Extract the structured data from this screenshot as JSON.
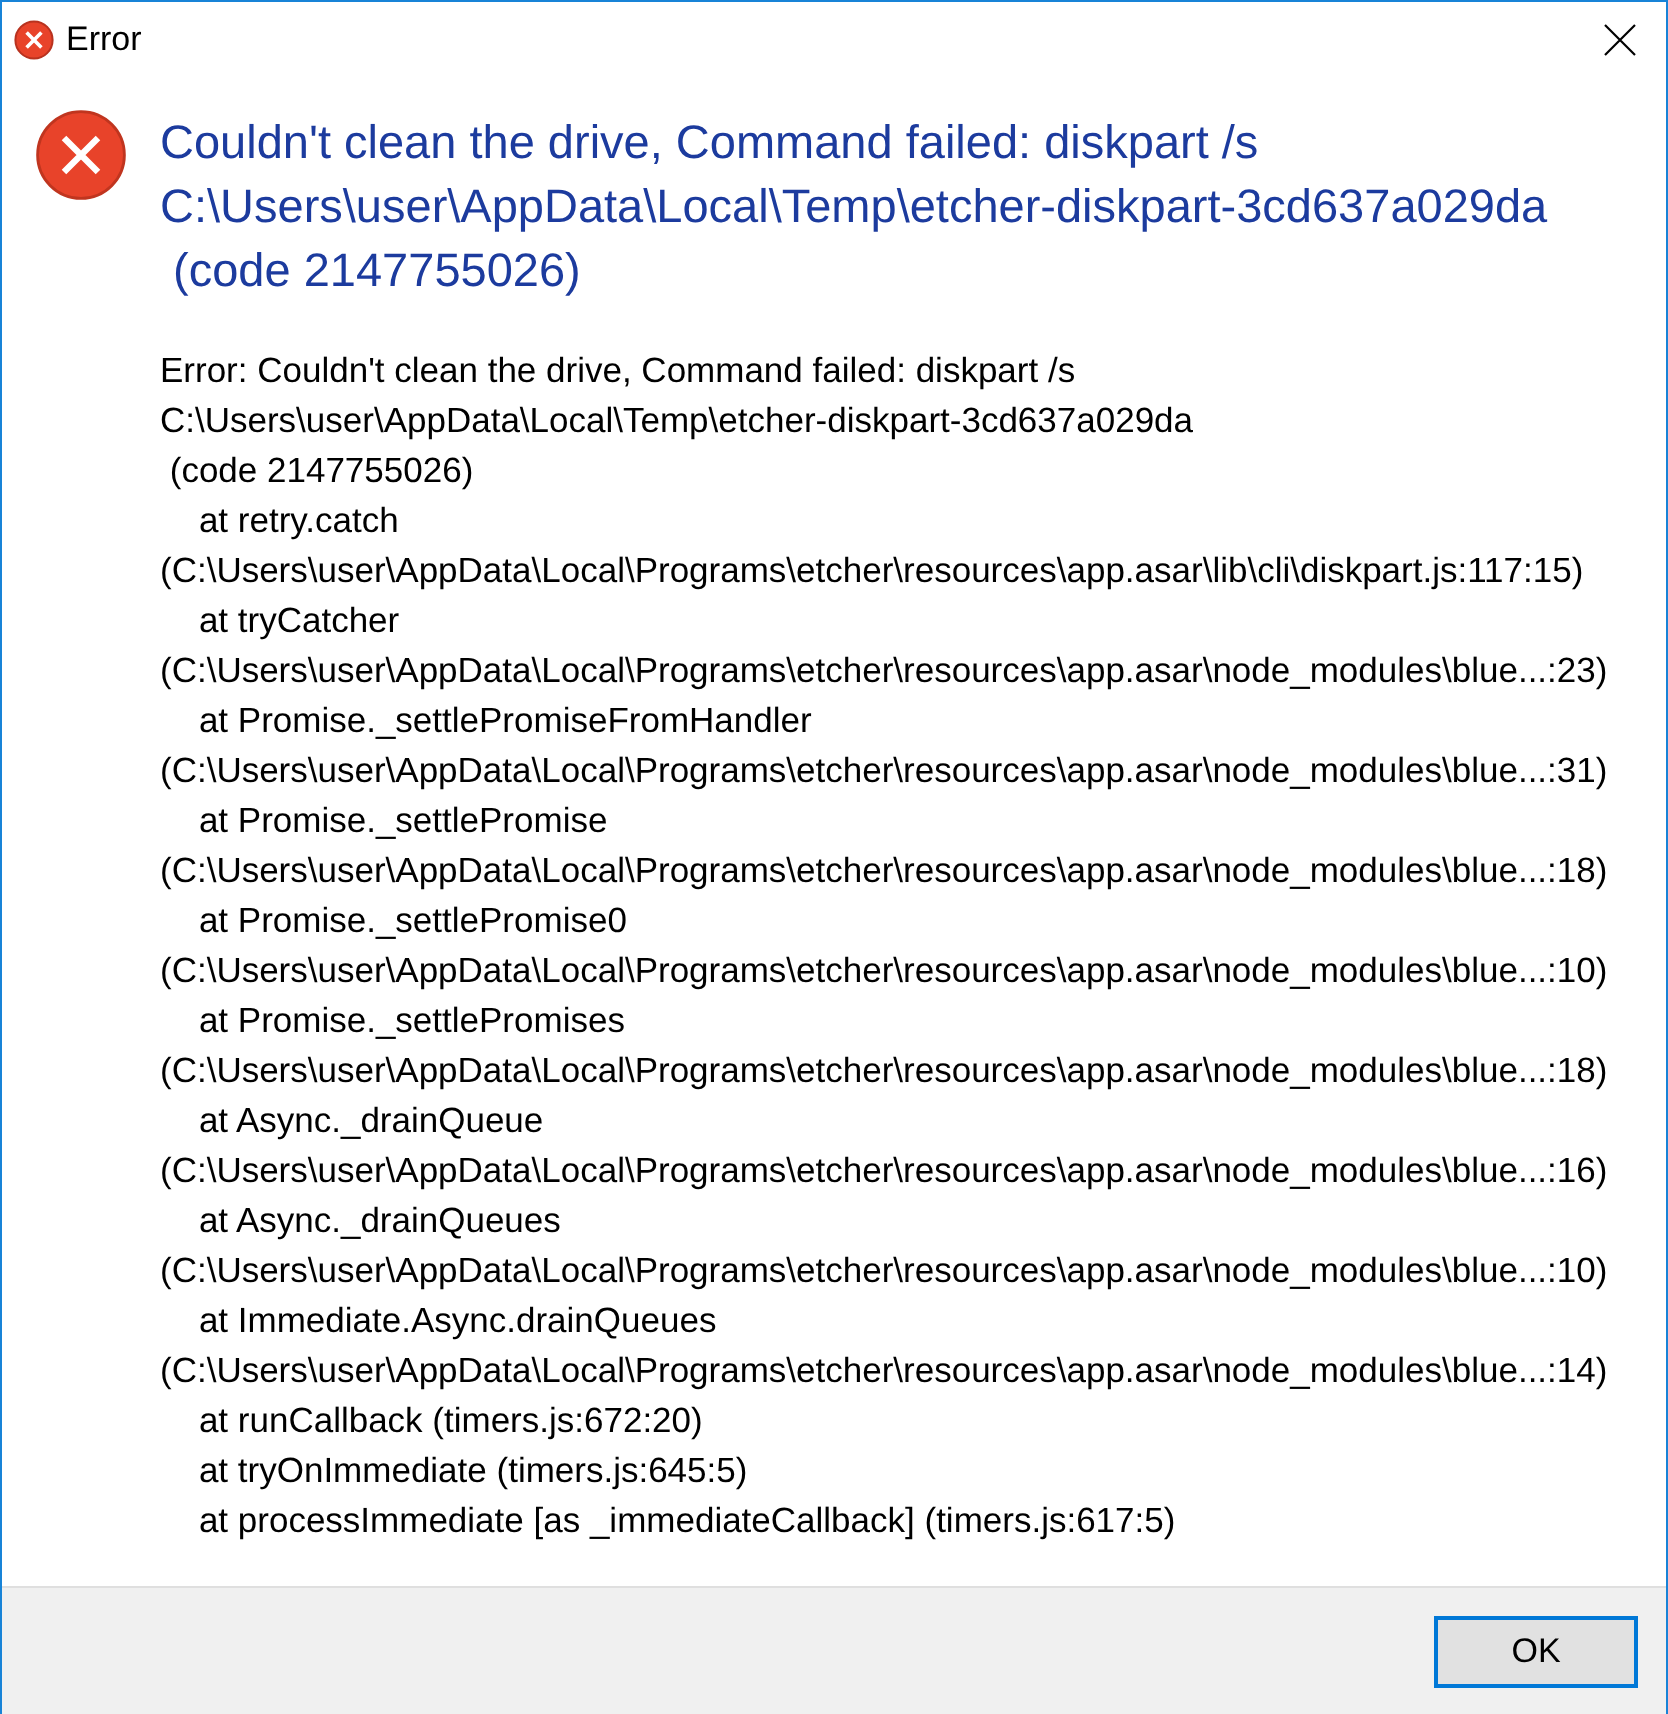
{
  "window": {
    "title": "Error"
  },
  "message": {
    "heading": "Couldn't clean the drive, Command failed: diskpart /s\nC:\\Users\\user\\AppData\\Local\\Temp\\etcher-diskpart-3cd637a029da\n (code 2147755026)",
    "details": "Error: Couldn't clean the drive, Command failed: diskpart /s\nC:\\Users\\user\\AppData\\Local\\Temp\\etcher-diskpart-3cd637a029da\n (code 2147755026)\n    at retry.catch\n(C:\\Users\\user\\AppData\\Local\\Programs\\etcher\\resources\\app.asar\\lib\\cli\\diskpart.js:117:15)\n    at tryCatcher\n(C:\\Users\\user\\AppData\\Local\\Programs\\etcher\\resources\\app.asar\\node_modules\\blue...:23)\n    at Promise._settlePromiseFromHandler\n(C:\\Users\\user\\AppData\\Local\\Programs\\etcher\\resources\\app.asar\\node_modules\\blue...:31)\n    at Promise._settlePromise\n(C:\\Users\\user\\AppData\\Local\\Programs\\etcher\\resources\\app.asar\\node_modules\\blue...:18)\n    at Promise._settlePromise0\n(C:\\Users\\user\\AppData\\Local\\Programs\\etcher\\resources\\app.asar\\node_modules\\blue...:10)\n    at Promise._settlePromises\n(C:\\Users\\user\\AppData\\Local\\Programs\\etcher\\resources\\app.asar\\node_modules\\blue...:18)\n    at Async._drainQueue\n(C:\\Users\\user\\AppData\\Local\\Programs\\etcher\\resources\\app.asar\\node_modules\\blue...:16)\n    at Async._drainQueues\n(C:\\Users\\user\\AppData\\Local\\Programs\\etcher\\resources\\app.asar\\node_modules\\blue...:10)\n    at Immediate.Async.drainQueues\n(C:\\Users\\user\\AppData\\Local\\Programs\\etcher\\resources\\app.asar\\node_modules\\blue...:14)\n    at runCallback (timers.js:672:20)\n    at tryOnImmediate (timers.js:645:5)\n    at processImmediate [as _immediateCallback] (timers.js:617:5)"
  },
  "buttons": [
    {
      "label": "OK",
      "default": true
    }
  ]
}
